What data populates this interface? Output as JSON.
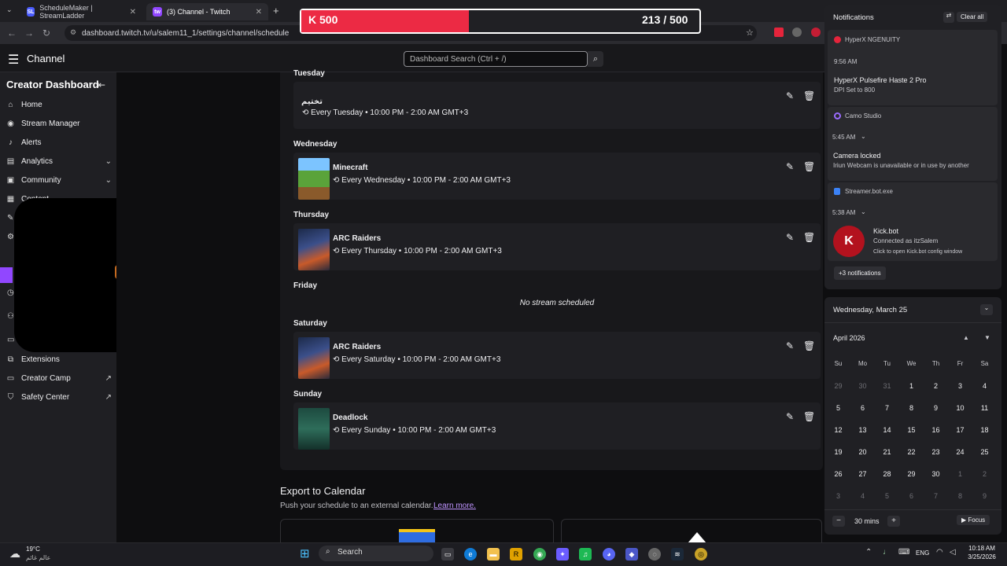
{
  "browser": {
    "tabs": [
      {
        "label": "ScheduleMaker | StreamLadder",
        "icon": "SL"
      },
      {
        "label": "(3) Channel - Twitch",
        "icon": "tw"
      }
    ],
    "url": "dashboard.twitch.tv/u/salem11_1/settings/channel/schedule"
  },
  "hud": {
    "left_value": "500",
    "right_value": "213 / 500",
    "progress": 0.42,
    "fill_color": "#ec2a44"
  },
  "topnav": {
    "title": "Channel",
    "search_placeholder": "Dashboard Search (Ctrl + /)"
  },
  "sidebar": {
    "title": "Creator Dashboard",
    "items": [
      {
        "label": "Home",
        "icon": "home-icon"
      },
      {
        "label": "Stream Manager",
        "icon": "broadcast-icon"
      },
      {
        "label": "Alerts",
        "icon": "bell-icon"
      },
      {
        "label": "Analytics",
        "icon": "chart-icon"
      },
      {
        "label": "Community",
        "icon": "people-icon"
      },
      {
        "label": "Content",
        "icon": "content-icon"
      },
      {
        "label": "Extensions",
        "icon": "extensions-icon"
      },
      {
        "label": "Creator Camp",
        "icon": "camp-icon"
      },
      {
        "label": "Safety Center",
        "icon": "shield-icon"
      }
    ]
  },
  "schedule": {
    "days": [
      {
        "day": "Tuesday",
        "name": "تختيم",
        "recurrence": "Every Tuesday",
        "time": "10:00 PM - 2:00 AM GMT+3"
      },
      {
        "day": "Wednesday",
        "name": "Minecraft",
        "recurrence": "Every Wednesday",
        "time": "10:00 PM - 2:00 AM GMT+3"
      },
      {
        "day": "Thursday",
        "name": "ARC Raiders",
        "recurrence": "Every Thursday",
        "time": "10:00 PM - 2:00 AM GMT+3"
      },
      {
        "day": "Friday",
        "empty": "No stream scheduled"
      },
      {
        "day": "Saturday",
        "name": "ARC Raiders",
        "recurrence": "Every Saturday",
        "time": "10:00 PM - 2:00 AM GMT+3"
      },
      {
        "day": "Sunday",
        "name": "Deadlock",
        "recurrence": "Every Sunday",
        "time": "10:00 PM - 2:00 AM GMT+3"
      }
    ],
    "export": {
      "title": "Export to Calendar",
      "subtitle": "Push your schedule to an external calendar.",
      "link": "Learn more."
    }
  },
  "notifications": {
    "title": "Notifications",
    "clear": "Clear all",
    "items": [
      {
        "app": "HyperX NGENUITY",
        "time": "9:56 AM",
        "title": "HyperX Pulsefire Haste 2 Pro",
        "body": "DPI Set to 800"
      },
      {
        "app": "Camo Studio",
        "time": "5:45 AM",
        "title": "Camera locked",
        "body": "Iriun Webcam is unavailable or in use by another"
      },
      {
        "app": "Streamer.bot.exe",
        "time": "5:38 AM",
        "title": "Kick.bot",
        "body": "Connected as itzSalem",
        "body2": "Click to open Kick.bot config window"
      }
    ],
    "more": "+3 notifications"
  },
  "calendar": {
    "date_header": "Wednesday, March 25",
    "month": "April 2026",
    "weekdays": [
      "Su",
      "Mo",
      "Tu",
      "We",
      "Th",
      "Fr",
      "Sa"
    ],
    "weeks": [
      [
        "29",
        "30",
        "31",
        "1",
        "2",
        "3",
        "4"
      ],
      [
        "5",
        "6",
        "7",
        "8",
        "9",
        "10",
        "11"
      ],
      [
        "12",
        "13",
        "14",
        "15",
        "16",
        "17",
        "18"
      ],
      [
        "19",
        "20",
        "21",
        "22",
        "23",
        "24",
        "25"
      ],
      [
        "26",
        "27",
        "28",
        "29",
        "30",
        "1",
        "2"
      ],
      [
        "3",
        "4",
        "5",
        "6",
        "7",
        "8",
        "9"
      ]
    ],
    "focus_minutes": "30 mins",
    "focus_label": "Focus"
  },
  "taskbar": {
    "weather_temp": "19°C",
    "weather_text": "عالم غائم",
    "search": "Search",
    "lang": "ENG",
    "time": "10:18 AM",
    "date": "3/25/2026"
  }
}
